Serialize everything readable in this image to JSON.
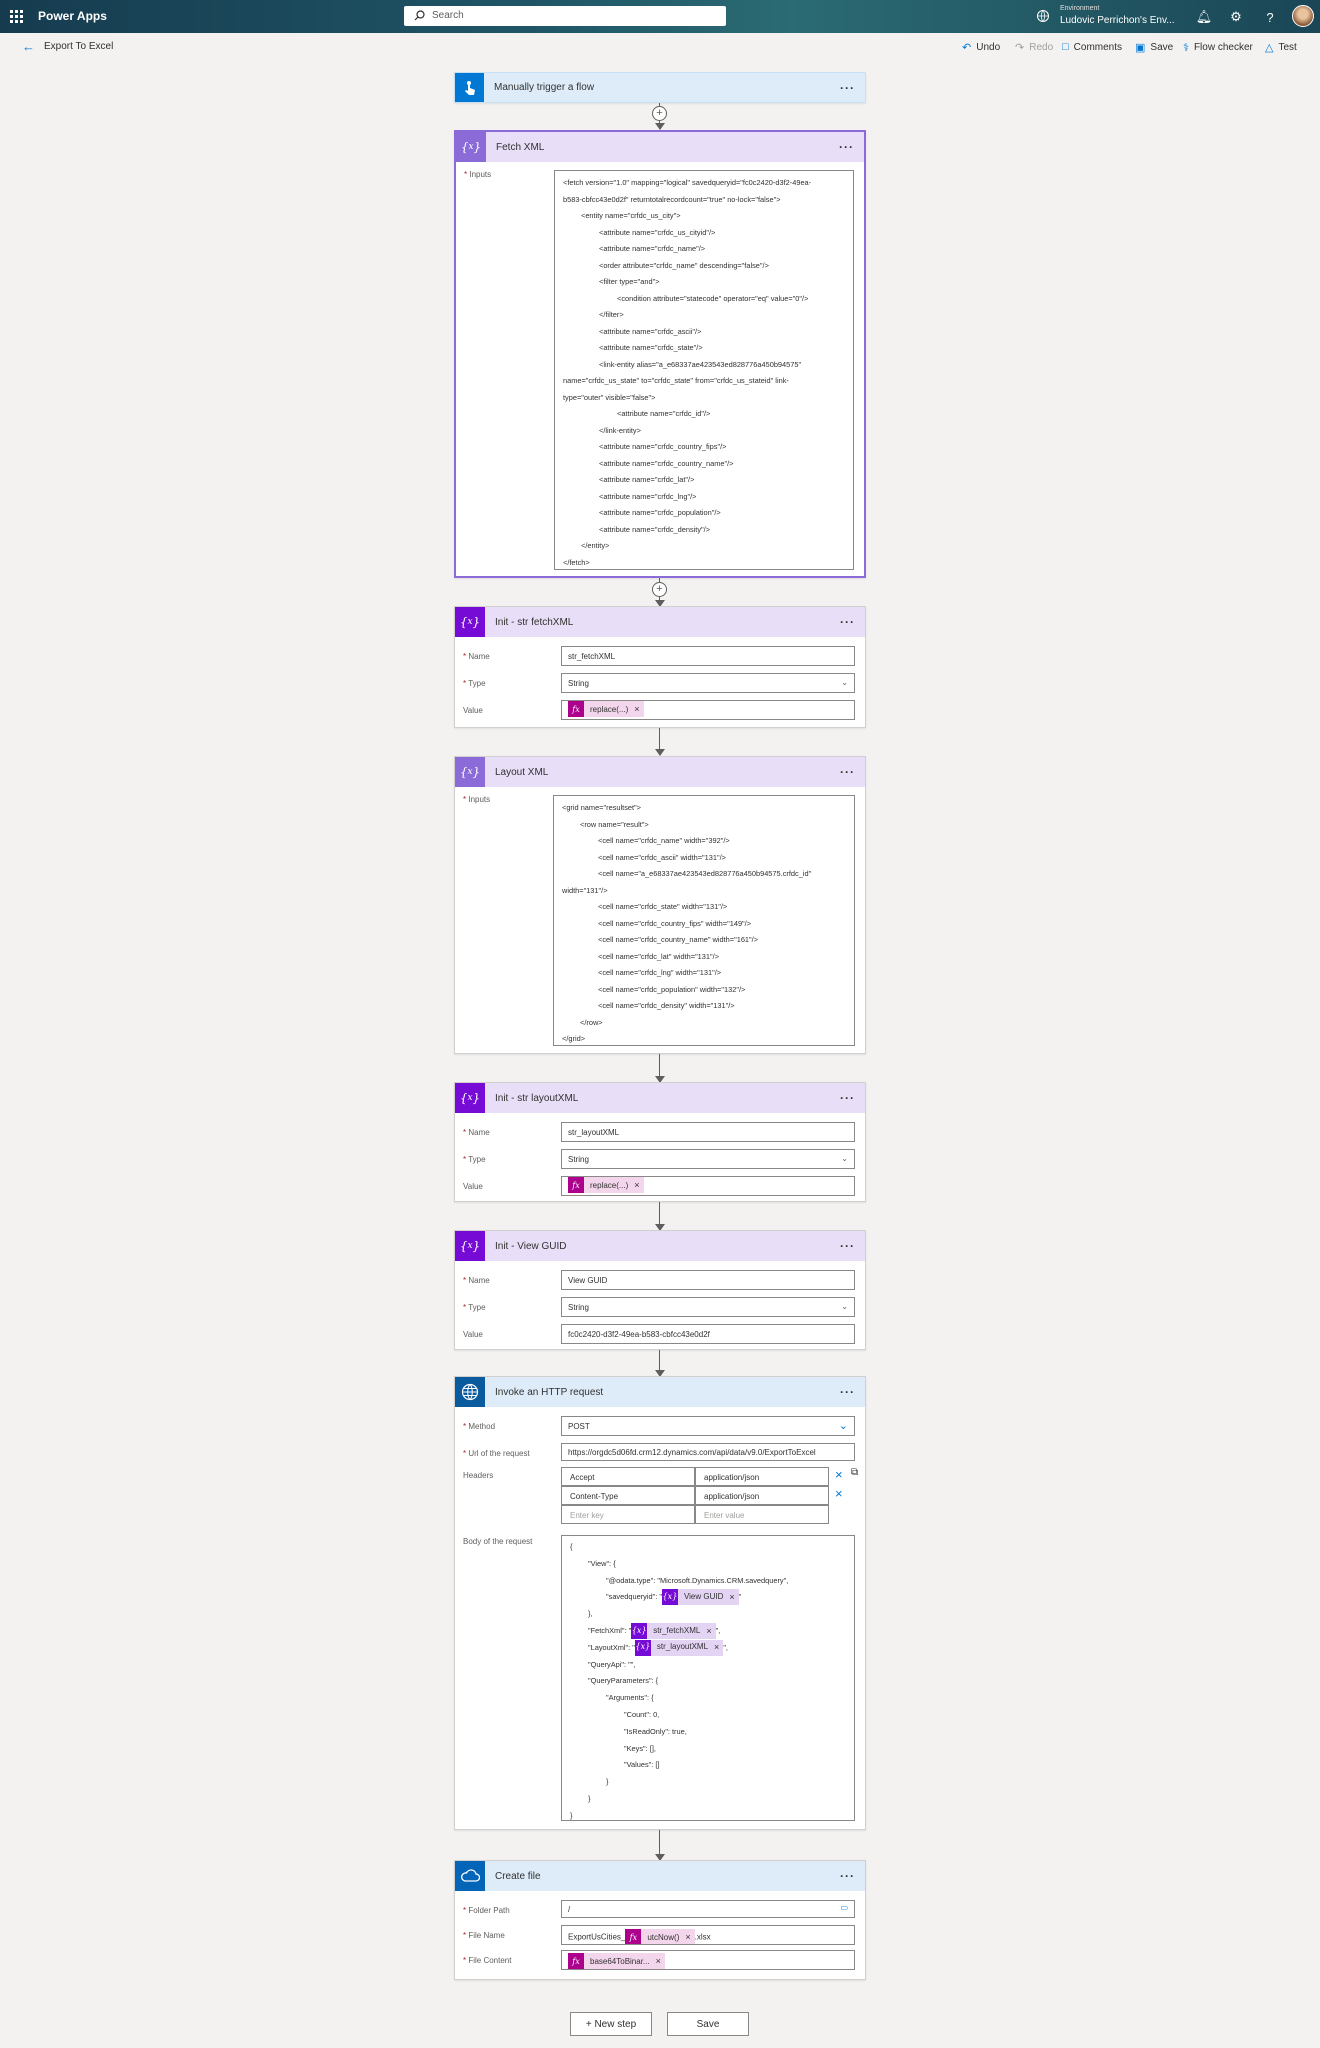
{
  "app": {
    "name": "Power Apps",
    "search_placeholder": "Search",
    "env_label": "Environment",
    "env_value": "Ludovic Perrichon's Env..."
  },
  "header": {
    "title": "Export To Excel",
    "undo": "Undo",
    "redo": "Redo",
    "comments": "Comments",
    "save": "Save",
    "flow_checker": "Flow checker",
    "test": "Test"
  },
  "trigger": {
    "title": "Manually trigger a flow"
  },
  "fetch": {
    "title": "Fetch XML",
    "inputs_label": "Inputs",
    "lines": [
      "<fetch version=\"1.0\" mapping=\"logical\" savedqueryid=\"fc0c2420-d3f2-49ea-",
      "b583-cbfcc43e0d2f\" returntotalrecordcount=\"true\" no-lock=\"false\">",
      "<entity name=\"crfdc_us_city\">",
      "<attribute name=\"crfdc_us_cityid\"/>",
      "<attribute name=\"crfdc_name\"/>",
      "<order attribute=\"crfdc_name\" descending=\"false\"/>",
      "<filter type=\"and\">",
      "<condition attribute=\"statecode\" operator=\"eq\" value=\"0\"/>",
      "</filter>",
      "<attribute name=\"crfdc_ascii\"/>",
      "<attribute name=\"crfdc_state\"/>",
      "<link-entity alias=\"a_e68337ae423543ed828776a450b94575\"",
      "name=\"crfdc_us_state\" to=\"crfdc_state\" from=\"crfdc_us_stateid\" link-",
      "type=\"outer\" visible=\"false\">",
      "<attribute name=\"crfdc_id\"/>",
      "</link-entity>",
      "<attribute name=\"crfdc_country_fips\"/>",
      "<attribute name=\"crfdc_country_name\"/>",
      "<attribute name=\"crfdc_lat\"/>",
      "<attribute name=\"crfdc_lng\"/>",
      "<attribute name=\"crfdc_population\"/>",
      "<attribute name=\"crfdc_density\"/>",
      "</entity>",
      "</fetch>"
    ]
  },
  "init_fetch": {
    "title": "Init - str fetchXML",
    "name_label": "Name",
    "name_value": "str_fetchXML",
    "type_label": "Type",
    "type_value": "String",
    "value_label": "Value",
    "value_token": "replace(...)"
  },
  "layout": {
    "title": "Layout XML",
    "inputs_label": "Inputs",
    "lines": [
      "<grid name=\"resultset\">",
      "<row name=\"result\">",
      "<cell name=\"crfdc_name\" width=\"392\"/>",
      "<cell name=\"crfdc_ascii\" width=\"131\"/>",
      "<cell name=\"a_e68337ae423543ed828776a450b94575.crfdc_id\"",
      "width=\"131\"/>",
      "<cell name=\"crfdc_state\" width=\"131\"/>",
      "<cell name=\"crfdc_country_fips\" width=\"149\"/>",
      "<cell name=\"crfdc_country_name\" width=\"161\"/>",
      "<cell name=\"crfdc_lat\" width=\"131\"/>",
      "<cell name=\"crfdc_lng\" width=\"131\"/>",
      "<cell name=\"crfdc_population\" width=\"132\"/>",
      "<cell name=\"crfdc_density\" width=\"131\"/>",
      "</row>",
      "</grid>"
    ]
  },
  "init_layout": {
    "title": "Init - str layoutXML",
    "name_label": "Name",
    "name_value": "str_layoutXML",
    "type_label": "Type",
    "type_value": "String",
    "value_label": "Value",
    "value_token": "replace(...)"
  },
  "init_guid": {
    "title": "Init - View GUID",
    "name_label": "Name",
    "name_value": "View GUID",
    "type_label": "Type",
    "type_value": "String",
    "value_label": "Value",
    "value_text": "fc0c2420-d3f2-49ea-b583-cbfcc43e0d2f"
  },
  "http": {
    "title": "Invoke an HTTP request",
    "method_label": "Method",
    "method_value": "POST",
    "url_label": "Url of the request",
    "url_value": "https://orgdc5d06fd.crm12.dynamics.com/api/data/v9.0/ExportToExcel",
    "headers_label": "Headers",
    "headers": [
      {
        "key": "Accept",
        "value": "application/json"
      },
      {
        "key": "Content-Type",
        "value": "application/json"
      }
    ],
    "key_placeholder": "Enter key",
    "value_placeholder": "Enter value",
    "body_label": "Body of the request",
    "body": {
      "l1": "{",
      "l2": "\"View\": {",
      "l3": "\"@odata.type\": \"Microsoft.Dynamics.CRM.savedquery\",",
      "l4_pre": "\"savedqueryid\": \"",
      "l4_token": "View GUID",
      "l4_post": "\"",
      "l5": "},",
      "l6_pre": "\"FetchXml\": \"",
      "l6_token": "str_fetchXML",
      "l6_post": "\",",
      "l7_pre": "\"LayoutXml\": \"",
      "l7_token": "str_layoutXML",
      "l7_post": "\",",
      "l8": "\"QueryApi\": \"\",",
      "l9": "\"QueryParameters\": {",
      "l10": "\"Arguments\": {",
      "l11": "\"Count\": 0,",
      "l12": "\"IsReadOnly\": true,",
      "l13": "\"Keys\": [],",
      "l14": "\"Values\": []",
      "l15": "}",
      "l16": "}",
      "l17": "}"
    }
  },
  "create": {
    "title": "Create file",
    "folder_label": "Folder Path",
    "folder_value": "/",
    "filename_label": "File Name",
    "filename_pre": "ExportUsCities_",
    "filename_token": "utcNow()",
    "filename_post": ".xlsx",
    "content_label": "File Content",
    "content_token": "base64ToBinar..."
  },
  "footer": {
    "new_step": "+ New step",
    "save": "Save"
  },
  "colors": {
    "purple": "#770bd6",
    "fx": "#ad008c",
    "trigger_blue": "#0078d4",
    "http_blue": "#0a5a9e",
    "onedrive_blue": "#0364b8"
  }
}
